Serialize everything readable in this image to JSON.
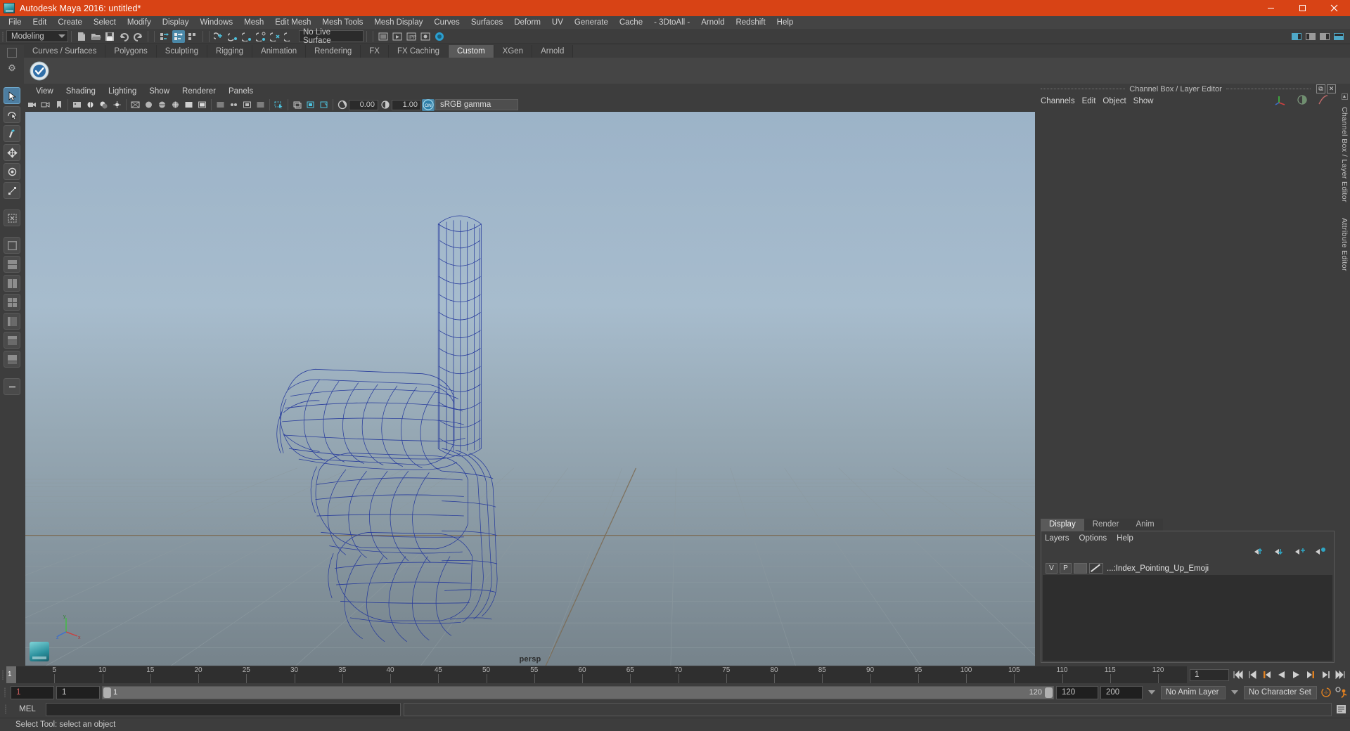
{
  "window": {
    "title": "Autodesk Maya 2016: untitled*",
    "minimize": "minimize-icon",
    "maximize": "maximize-icon",
    "close": "close-icon"
  },
  "menubar": {
    "items": [
      "File",
      "Edit",
      "Create",
      "Select",
      "Modify",
      "Display",
      "Windows",
      "Mesh",
      "Edit Mesh",
      "Mesh Tools",
      "Mesh Display",
      "Curves",
      "Surfaces",
      "Deform",
      "UV",
      "Generate",
      "Cache",
      "- 3DtoAll -",
      "Arnold",
      "Redshift",
      "Help"
    ]
  },
  "statusline": {
    "menuset": "Modeling",
    "live_surface": "No Live Surface"
  },
  "shelf": {
    "tabs": [
      "Curves / Surfaces",
      "Polygons",
      "Sculpting",
      "Rigging",
      "Animation",
      "Rendering",
      "FX",
      "FX Caching",
      "Custom",
      "XGen",
      "Arnold"
    ],
    "active_tab": "Custom"
  },
  "viewport": {
    "menu": [
      "View",
      "Shading",
      "Lighting",
      "Show",
      "Renderer",
      "Panels"
    ],
    "exposure": "0.00",
    "gamma": "1.00",
    "color_space": "sRGB gamma",
    "camera_label": "persp",
    "axis_x": "x",
    "axis_y": "y",
    "axis_z": "z"
  },
  "channelbox": {
    "title": "Channel Box / Layer Editor",
    "menu": [
      "Channels",
      "Edit",
      "Object",
      "Show"
    ]
  },
  "layer_editor": {
    "tabs": [
      "Display",
      "Render",
      "Anim"
    ],
    "active_tab": "Display",
    "menu": [
      "Layers",
      "Options",
      "Help"
    ],
    "layers": [
      {
        "visibility": "V",
        "playback": "P",
        "name": "...:Index_Pointing_Up_Emoji"
      }
    ]
  },
  "vertical_tabs": [
    "Channel Box / Layer Editor",
    "Attribute Editor"
  ],
  "timeslider": {
    "current_frame": "1",
    "end_label": "120",
    "ticks": [
      {
        "label": "5",
        "value": 5
      },
      {
        "label": "10",
        "value": 10
      },
      {
        "label": "15",
        "value": 15
      },
      {
        "label": "20",
        "value": 20
      },
      {
        "label": "25",
        "value": 25
      },
      {
        "label": "30",
        "value": 30
      },
      {
        "label": "35",
        "value": 35
      },
      {
        "label": "40",
        "value": 40
      },
      {
        "label": "45",
        "value": 45
      },
      {
        "label": "50",
        "value": 50
      },
      {
        "label": "55",
        "value": 55
      },
      {
        "label": "60",
        "value": 60
      },
      {
        "label": "65",
        "value": 65
      },
      {
        "label": "70",
        "value": 70
      },
      {
        "label": "75",
        "value": 75
      },
      {
        "label": "80",
        "value": 80
      },
      {
        "label": "85",
        "value": 85
      },
      {
        "label": "90",
        "value": 90
      },
      {
        "label": "95",
        "value": 95
      },
      {
        "label": "100",
        "value": 100
      },
      {
        "label": "105",
        "value": 105
      },
      {
        "label": "110",
        "value": 110
      },
      {
        "label": "115",
        "value": 115
      },
      {
        "label": "120",
        "value": 120
      }
    ],
    "frame_field": "1"
  },
  "rangeslider": {
    "anim_start": "1",
    "range_start": "1",
    "bar_start": "1",
    "bar_end": "120",
    "range_end": "120",
    "anim_end": "200",
    "anim_layer": "No Anim Layer",
    "character_set": "No Character Set"
  },
  "commandline": {
    "label": "MEL",
    "input_value": "",
    "output_value": ""
  },
  "helpline": {
    "text": "Select Tool: select an object"
  }
}
